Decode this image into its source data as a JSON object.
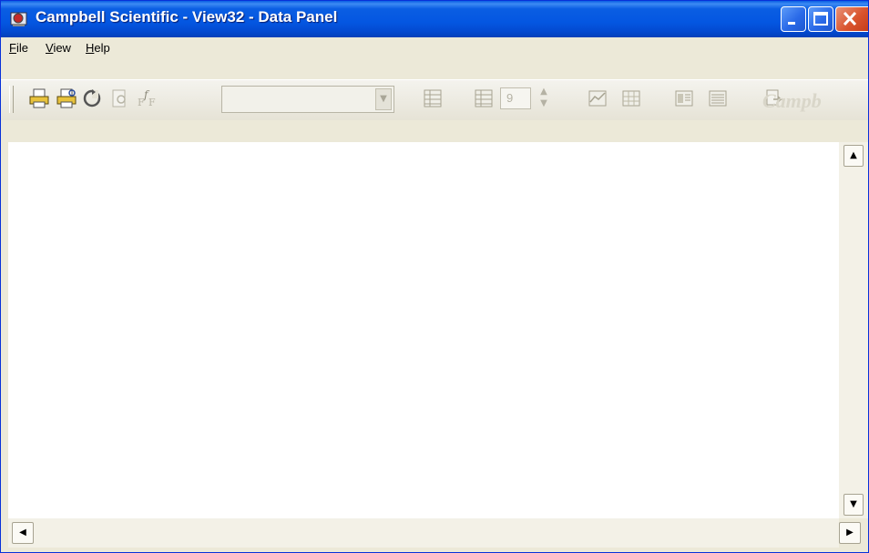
{
  "window": {
    "title": "Campbell Scientific - View32 - Data Panel",
    "titlebar_color": "#0a5ee3",
    "close_color": "#d9532d"
  },
  "menubar": {
    "items": [
      {
        "label": "File",
        "accel": "F"
      },
      {
        "label": "View",
        "accel": "V"
      },
      {
        "label": "Help",
        "accel": "H"
      }
    ]
  },
  "toolbar": {
    "icons": [
      "print-icon",
      "print-preview-icon",
      "refresh-icon",
      "page-view-icon",
      "function-icon",
      "table-icon",
      "table-alt-icon",
      "graph-icon",
      "graph-alt-icon",
      "report-icon",
      "report-alt-icon",
      "export-icon"
    ],
    "combo_value": "",
    "spinner_value": "9",
    "watermark": "Campb"
  }
}
